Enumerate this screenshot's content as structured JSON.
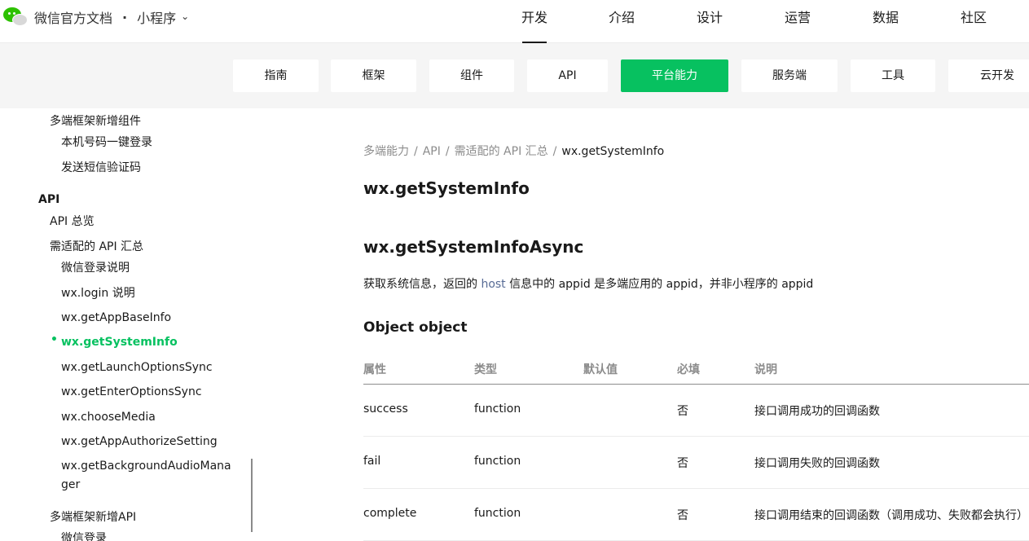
{
  "header": {
    "brand_title": "微信官方文档",
    "brand_separator": "·",
    "product": "小程序",
    "nav": [
      "开发",
      "介绍",
      "设计",
      "运营",
      "数据",
      "社区"
    ],
    "active_nav": "开发"
  },
  "subnav": {
    "tabs": [
      "指南",
      "框架",
      "组件",
      "API",
      "平台能力",
      "服务端",
      "工具",
      "云开发"
    ],
    "active": "平台能力"
  },
  "sidebar": {
    "items": [
      {
        "label": "多端框架新增组件"
      },
      {
        "label": "本机号码一键登录"
      },
      {
        "label": "发送短信验证码"
      },
      {
        "label": "API"
      },
      {
        "label": "API 总览"
      },
      {
        "label": "需适配的 API 汇总"
      },
      {
        "label": "微信登录说明"
      },
      {
        "label": "wx.login 说明"
      },
      {
        "label": "wx.getAppBaseInfo"
      },
      {
        "label": "wx.getSystemInfo"
      },
      {
        "label": "wx.getLaunchOptionsSync"
      },
      {
        "label": "wx.getEnterOptionsSync"
      },
      {
        "label": "wx.chooseMedia"
      },
      {
        "label": "wx.getAppAuthorizeSetting"
      },
      {
        "label": "wx.getBackgroundAudioMana"
      },
      {
        "label": "ger"
      },
      {
        "label": "多端框架新增API"
      },
      {
        "label": "微信登录"
      }
    ],
    "bullet": "•"
  },
  "breadcrumb": {
    "items": [
      "多端能力",
      "API",
      "需适配的 API 汇总",
      "wx.getSystemInfo"
    ],
    "separator": "/"
  },
  "content": {
    "title": "wx.getSystemInfo",
    "subtitle": "wx.getSystemInfoAsync",
    "desc_before": "获取系统信息，返回的 ",
    "desc_link": "host",
    "desc_after": " 信息中的 appid 是多端应用的 appid，并非小程序的 appid",
    "section": "Object object"
  },
  "table": {
    "headers": [
      "属性",
      "类型",
      "默认值",
      "必填",
      "说明"
    ],
    "rows": [
      [
        "success",
        "function",
        "",
        "否",
        "接口调用成功的回调函数"
      ],
      [
        "fail",
        "function",
        "",
        "否",
        "接口调用失败的回调函数"
      ],
      [
        "complete",
        "function",
        "",
        "否",
        "接口调用结束的回调函数（调用成功、失败都会执行）"
      ]
    ]
  },
  "colors": {
    "accent": "#07c160",
    "link": "#576b95",
    "band": "#f5f5f5"
  }
}
